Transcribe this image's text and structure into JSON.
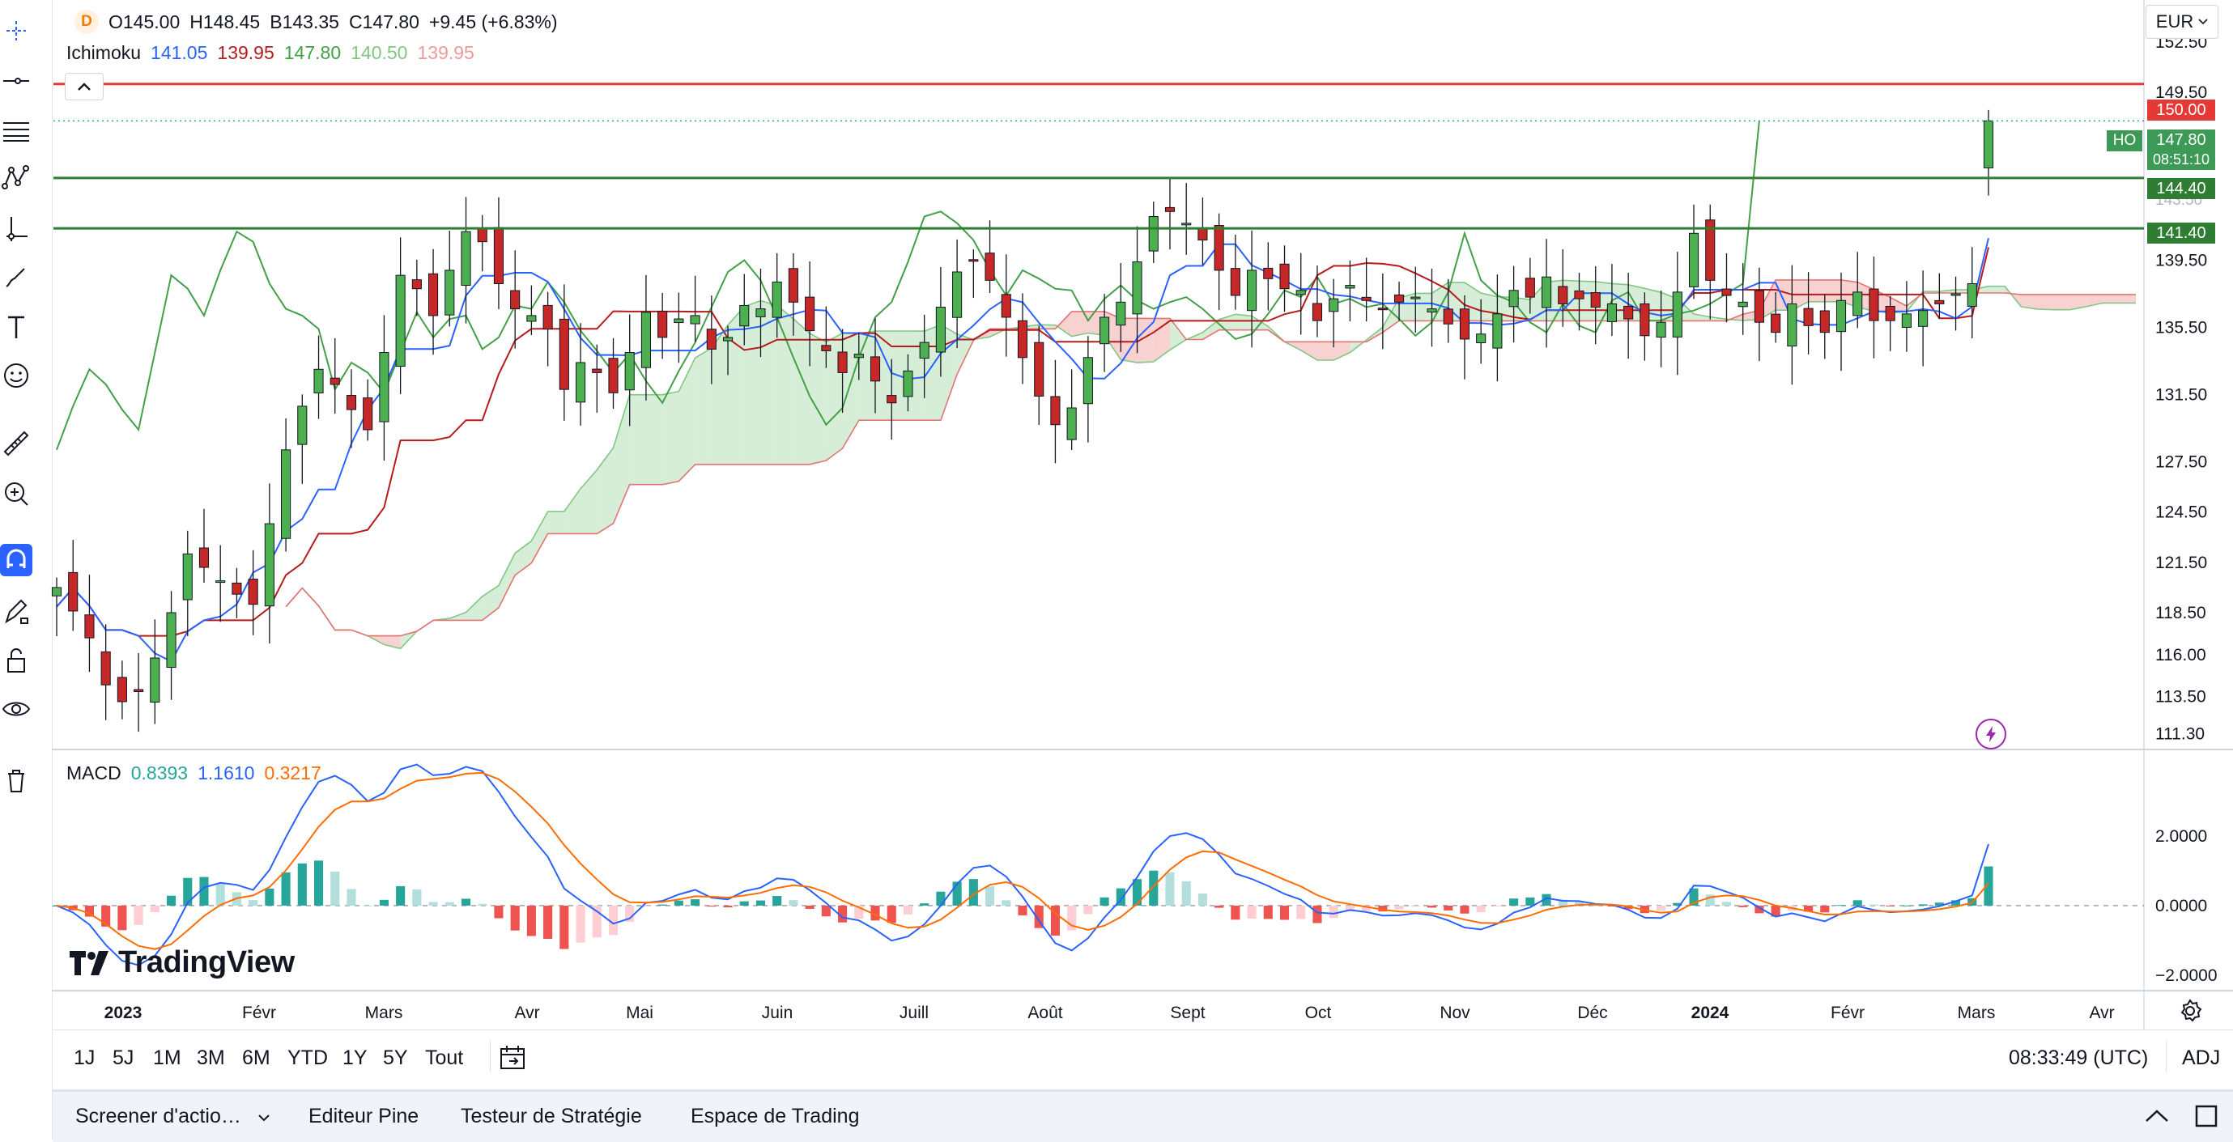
{
  "header": {
    "symbol_badge": "D",
    "ohlc": {
      "o_label": "O",
      "o": "145.00",
      "h_label": "H",
      "h": "148.45",
      "b_label": "B",
      "b": "143.35",
      "c_label": "C",
      "c": "147.80",
      "change": "+9.45 (+6.83%)"
    },
    "ichimoku": {
      "label": "Ichimoku",
      "v1": "141.05",
      "v2": "139.95",
      "v3": "147.80",
      "v4": "140.50",
      "v5": "139.95"
    }
  },
  "macd_legend": {
    "label": "MACD",
    "v1": "0.8393",
    "v2": "1.1610",
    "v3": "0.3217"
  },
  "currency": "EUR",
  "price_tags": {
    "red": "150.00",
    "last": "147.80",
    "countdown": "08:51:10",
    "green1": "144.40",
    "green2": "141.40",
    "ho": "HO",
    "hidden_tick": "143.50"
  },
  "time_display": "08:33:49 (UTC)",
  "adj": "ADJ",
  "logo_text": "TradingView",
  "ranges": [
    "1J",
    "5J",
    "1M",
    "3M",
    "6M",
    "YTD",
    "1Y",
    "5Y",
    "Tout"
  ],
  "bottom_tabs": [
    "Screener d'actio…",
    "Editeur Pine",
    "Testeur de Stratégie",
    "Espace de Trading"
  ],
  "colors": {
    "up": "#26a69a",
    "down": "#ef5350",
    "candle_up": "#4caf50",
    "candle_down": "#c62828",
    "tenkan": "#2962ff",
    "kijun": "#b71c1c",
    "chikou": "#43a047",
    "cloud_up": "#a5d6a7",
    "cloud_down": "#ef9a9a",
    "macd": "#2962ff",
    "signal": "#ff6d00",
    "resistance": "#e53935",
    "support": "#2e7d32"
  },
  "chart_data": {
    "type": "candlestick",
    "y_ticks": [
      152.5,
      149.5,
      143.5,
      139.5,
      135.5,
      131.5,
      127.5,
      124.5,
      121.5,
      118.5,
      116.0,
      113.5,
      111.3
    ],
    "y_tick_labels": [
      "152.50",
      "149.50",
      "143.50",
      "139.50",
      "135.50",
      "131.50",
      "127.50",
      "124.50",
      "121.50",
      "118.50",
      "116.00",
      "113.50",
      "111.30"
    ],
    "ylim": [
      110.4,
      155.0
    ],
    "x_labels": [
      "2023",
      "Févr",
      "Mars",
      "Avr",
      "Mai",
      "Juin",
      "Juill",
      "Août",
      "Sept",
      "Oct",
      "Nov",
      "Déc",
      "2024",
      "Févr",
      "Mars",
      "Avr"
    ],
    "x_label_bold": [
      true,
      false,
      false,
      false,
      false,
      false,
      false,
      false,
      false,
      false,
      false,
      false,
      true,
      false,
      false,
      false
    ],
    "horizontal_lines": [
      {
        "price": 150.0,
        "color": "resistance"
      },
      {
        "price": 144.4,
        "color": "support"
      },
      {
        "price": 141.4,
        "color": "support"
      }
    ],
    "last_price": 147.8,
    "closes": [
      120.0,
      118.6,
      117.0,
      114.2,
      113.2,
      113.8,
      115.8,
      118.5,
      122.0,
      121.2,
      120.4,
      119.6,
      119.0,
      123.8,
      128.2,
      130.8,
      133.0,
      132.1,
      130.6,
      129.4,
      134.0,
      138.6,
      137.8,
      136.2,
      138.9,
      141.2,
      140.6,
      138.1,
      136.6,
      136.2,
      135.4,
      131.8,
      133.4,
      132.8,
      131.6,
      134.0,
      136.4,
      134.9,
      136.0,
      136.2,
      134.2,
      134.9,
      136.8,
      136.6,
      138.2,
      137.0,
      135.3,
      134.1,
      132.8,
      133.9,
      132.3,
      131.0,
      132.9,
      134.6,
      136.7,
      138.8,
      139.5,
      138.3,
      136.1,
      133.7,
      131.4,
      129.7,
      130.7,
      133.7,
      136.1,
      137.0,
      139.4,
      142.1,
      142.4,
      141.7,
      140.7,
      138.9,
      137.4,
      138.9,
      138.4,
      137.8,
      137.7,
      135.9,
      137.2,
      138.0,
      137.1,
      136.6,
      137.0,
      137.3,
      136.6,
      135.7,
      134.8,
      135.1,
      136.3,
      137.7,
      137.3,
      138.5,
      136.9,
      137.2,
      136.7,
      136.9,
      136.0,
      135.0,
      135.8,
      137.6,
      141.1,
      138.3,
      137.4,
      137.0,
      135.8,
      135.2,
      136.9,
      135.6,
      135.2,
      137.1,
      137.6,
      135.9,
      135.9,
      136.3,
      136.5,
      136.9,
      137.5,
      138.1,
      147.8
    ],
    "macd_ylim": [
      -2.4,
      4.4
    ],
    "macd_ticks": [
      2.0,
      0.0,
      -2.0
    ],
    "macd_tick_labels": [
      "2.0000",
      "0.0000",
      "−2.0000"
    ],
    "macd_series": [
      {
        "name": "MACD",
        "value": "1.1610"
      },
      {
        "name": "Signal",
        "value": "0.3217"
      },
      {
        "name": "Histogram",
        "value": "0.8393"
      }
    ]
  }
}
